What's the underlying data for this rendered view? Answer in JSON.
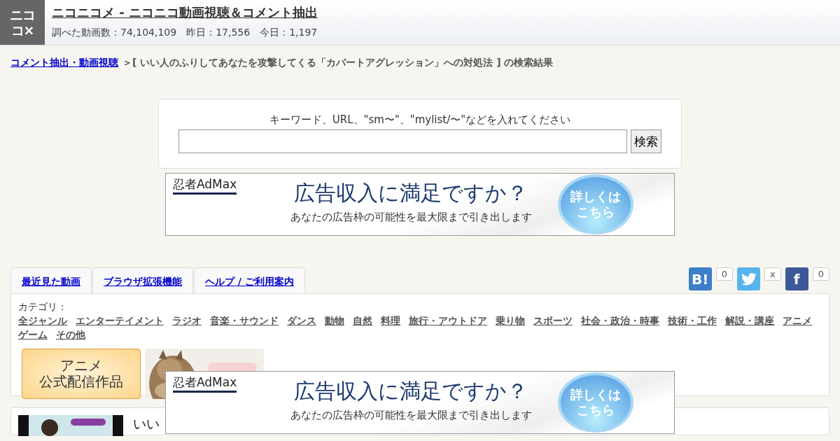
{
  "header": {
    "logo": [
      "ニコ",
      "コ×"
    ],
    "title": "ニコニコメ - ニコニコ動画視聴＆コメント抽出",
    "stats": "調べた動画数：74,104,109　昨日：17,556　今日：1,197"
  },
  "breadcrumb": {
    "link": "コメント抽出・動画視聴",
    "current": "＞[ いい人のふりしてあなたを攻撃してくる「カバートアグレッション」への対処法 ] の検索結果"
  },
  "search": {
    "label": "キーワード、URL、\"sm〜\"、\"mylist/〜\"などを入れてください",
    "button": "検索"
  },
  "ads": [
    {
      "brand": "忍者",
      "product": "AdMax",
      "headline": "広告収入に満足ですか？",
      "sub": "あなたの広告枠の可能性を最大限まで引き出します",
      "cta": [
        "詳しくは",
        "こちら"
      ]
    },
    {
      "brand": "忍者",
      "product": "AdMax",
      "headline": "広告収入に満足ですか？",
      "sub": "あなたの広告枠の可能性を最大限まで引き出します",
      "cta": [
        "詳しくは",
        "こちら"
      ]
    }
  ],
  "tabs": [
    {
      "label": "最近見た動画"
    },
    {
      "label": "ブラウザ拡張機能"
    },
    {
      "label": "ヘルプ / ご利用案内"
    }
  ],
  "share": [
    {
      "kind": "hatena",
      "label": "B!",
      "count": "0"
    },
    {
      "kind": "twitter",
      "count": "x"
    },
    {
      "kind": "facebook",
      "label": "f",
      "count": "0"
    }
  ],
  "categories": {
    "label": "カテゴリ：",
    "items": [
      "全ジャンル",
      "エンターテイメント",
      "ラジオ",
      "音楽・サウンド",
      "ダンス",
      "動物",
      "自然",
      "料理",
      "旅行・アウトドア",
      "乗り物",
      "スポーツ",
      "社会・政治・時事",
      "技術・工作",
      "解説・講座",
      "アニメ",
      "ゲーム",
      "その他"
    ]
  },
  "banners": [
    {
      "kind": "anime",
      "lines": [
        "アニメ",
        "公式配信作品"
      ]
    },
    {
      "kind": "picture"
    }
  ],
  "results": [
    {
      "title": "いい"
    }
  ]
}
